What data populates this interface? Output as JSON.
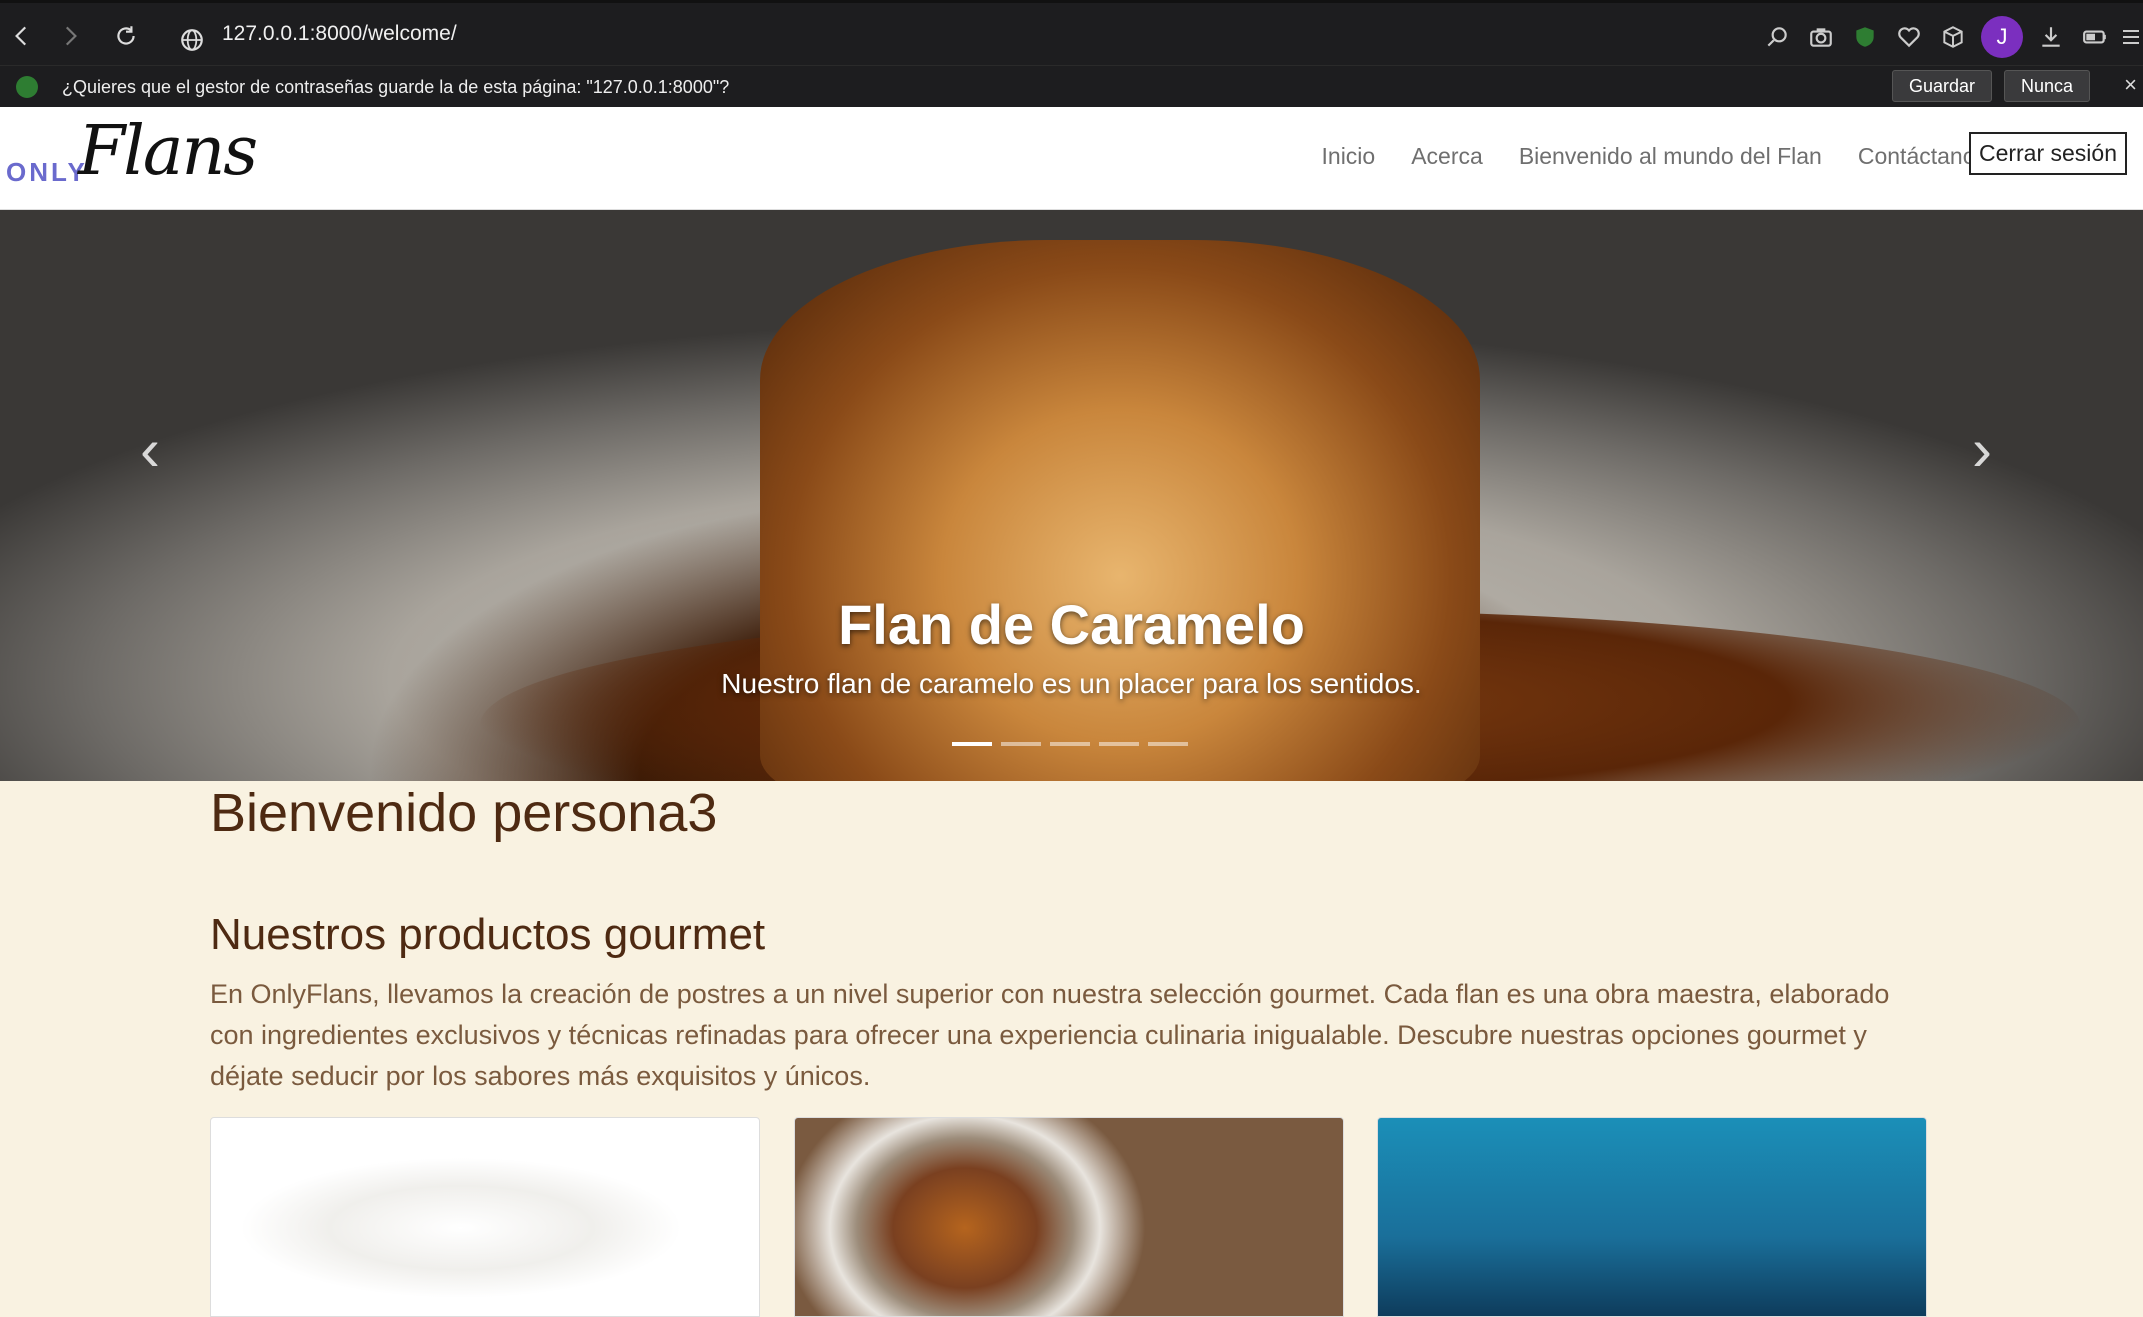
{
  "browser": {
    "url": "127.0.0.1:8000/welcome/",
    "avatar_letter": "J",
    "icons": [
      "back-icon",
      "forward-icon",
      "reload-icon",
      "globe-icon",
      "zoom-icon",
      "camera-icon",
      "shield-icon",
      "heart-icon",
      "cube-icon",
      "download-icon",
      "battery-icon",
      "menu-icon"
    ]
  },
  "password_bar": {
    "message": "¿Quieres que el gestor de contraseñas guarde la de esta página: \"127.0.0.1:8000\"?",
    "save_label": "Guardar",
    "never_label": "Nunca",
    "close": "×"
  },
  "navbar": {
    "logo_only": "ONLY",
    "logo_flans": "Flans",
    "links": [
      "Inicio",
      "Acerca",
      "Bienvenido al mundo del Flan",
      "Contáctanos"
    ],
    "logout_label": "Cerrar sesión"
  },
  "hero": {
    "title": "Flan de Caramelo",
    "text": "Nuestro flan de caramelo es un placer para los sentidos.",
    "prev": "‹",
    "next": "›",
    "slide_count": 5,
    "active_slide": 1
  },
  "main": {
    "welcome": "Bienvenido persona3",
    "section_title": "Nuestros productos gourmet",
    "paragraph": "En OnlyFlans, llevamos la creación de postres a un nivel superior con nuestra selección gourmet. Cada flan es una obra maestra, elaborado con ingredientes exclusivos y técnicas refinadas para ofrecer una experiencia culinaria inigualable. Descubre nuestras opciones gourmet y déjate seducir por los sabores más exquisitos y únicos."
  }
}
